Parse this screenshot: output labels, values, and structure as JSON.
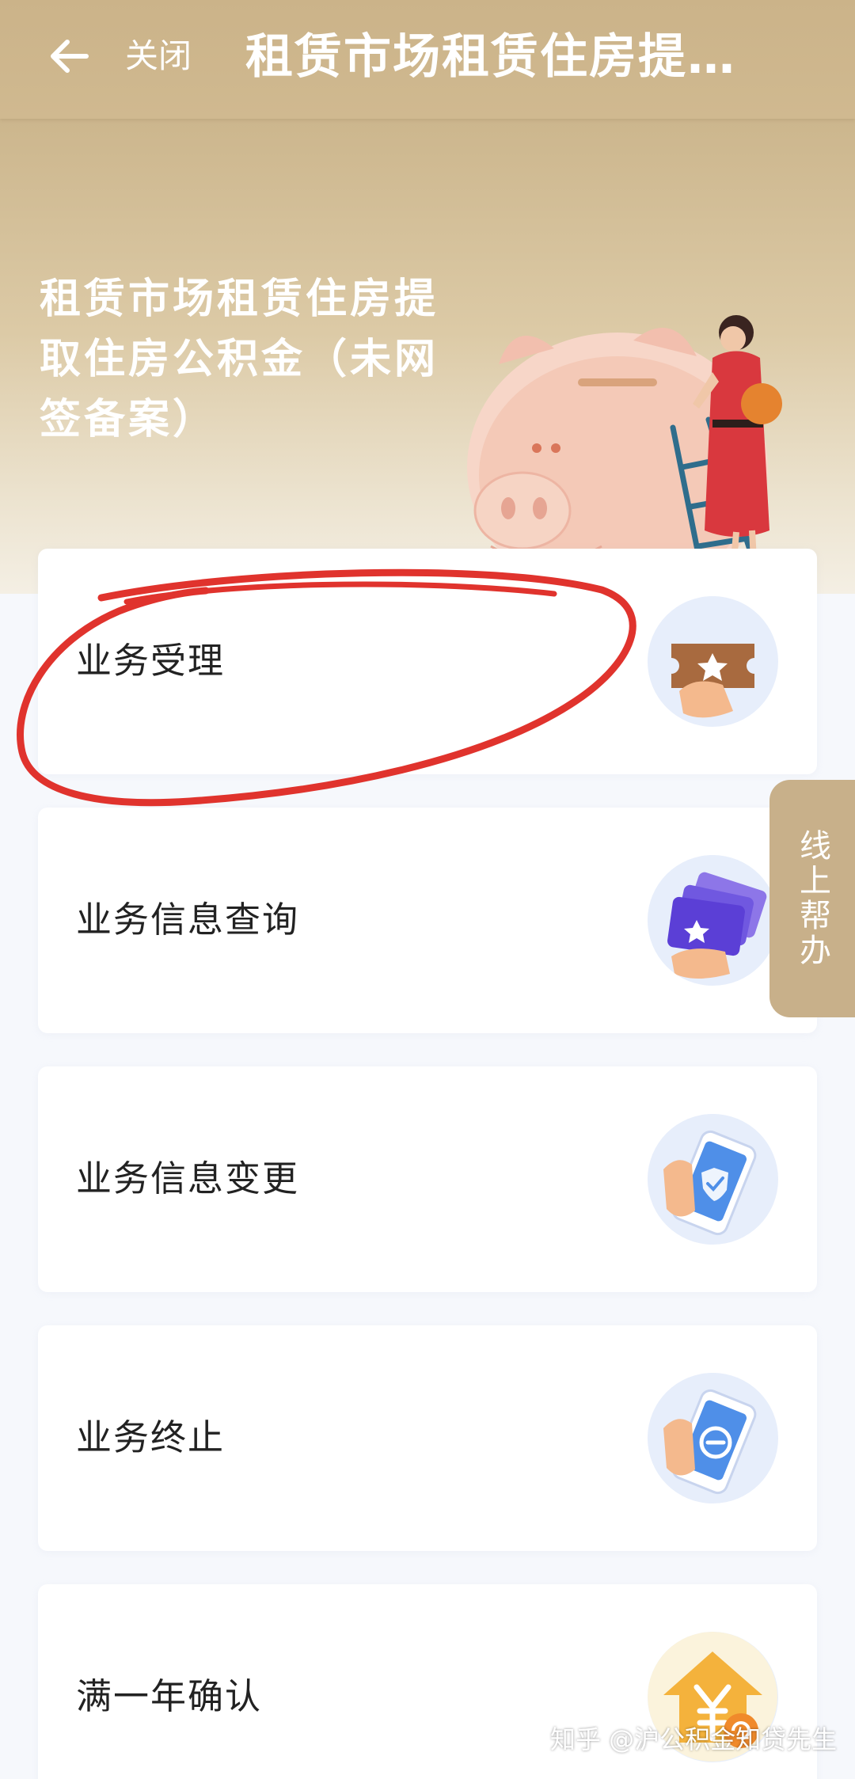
{
  "navbar": {
    "close_label": "关闭",
    "title": "租赁市场租赁住房提…",
    "back_icon": "arrow-left-icon"
  },
  "hero": {
    "title": "租赁市场租赁住房提取住房公积金（未网签备案）",
    "illustration": "piggy-bank-ladder-illustration"
  },
  "menu": [
    {
      "label": "业务受理",
      "icon": "ticket-star-icon"
    },
    {
      "label": "业务信息查询",
      "icon": "cards-star-icon"
    },
    {
      "label": "业务信息变更",
      "icon": "phone-shield-check-icon"
    },
    {
      "label": "业务终止",
      "icon": "phone-stop-icon"
    },
    {
      "label": "满一年确认",
      "icon": "house-yen-icon"
    }
  ],
  "help_tab": {
    "label": "线上帮办"
  },
  "watermark": "知乎 @沪公积金知贷先生",
  "colors": {
    "header": "#cbb389",
    "annotation": "#e0332d",
    "help_tab": "#c8b08a",
    "page_bg": "#f6f8fc"
  }
}
